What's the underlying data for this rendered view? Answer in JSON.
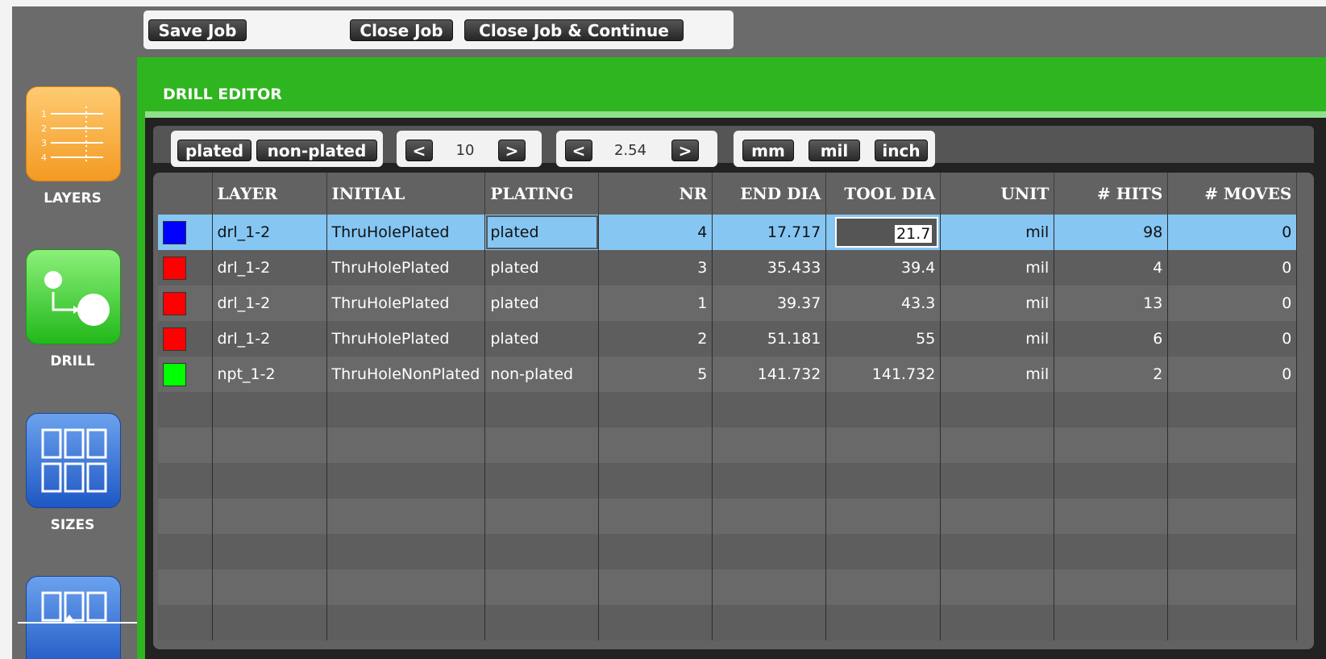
{
  "toolbar": {
    "save_job": "Save Job",
    "close_job": "Close Job",
    "close_continue": "Close Job & Continue"
  },
  "sidebar": {
    "items": [
      {
        "label": "LAYERS",
        "icon": "layers-icon"
      },
      {
        "label": "DRILL",
        "icon": "drill-icon"
      },
      {
        "label": "SIZES",
        "icon": "sizes-icon"
      },
      {
        "label": "",
        "icon": "sizes-icon"
      }
    ],
    "layer_numbers": [
      "1",
      "2",
      "3",
      "4"
    ]
  },
  "editor": {
    "title": "DRILL EDITOR",
    "plating_buttons": [
      "plated",
      "non-plated"
    ],
    "count_prev": "<",
    "count_value": "10",
    "count_next": ">",
    "step_prev": "<",
    "step_value": "2.54",
    "step_next": ">",
    "unit_buttons": [
      "mm",
      "mil",
      "inch"
    ]
  },
  "table": {
    "columns": [
      "",
      "LAYER",
      "INITIAL",
      "PLATING",
      "NR",
      "END DIA",
      "TOOL DIA",
      "UNIT",
      "# HITS",
      "# MOVES"
    ],
    "rows": [
      {
        "color": "#0000ff",
        "layer": "drl_1-2",
        "initial": "ThruHolePlated",
        "plating": "plated",
        "nr": "4",
        "end_dia": "17.717",
        "tool_dia": "21.7",
        "unit": "mil",
        "hits": "98",
        "moves": "0"
      },
      {
        "color": "#ff0000",
        "layer": "drl_1-2",
        "initial": "ThruHolePlated",
        "plating": "plated",
        "nr": "3",
        "end_dia": "35.433",
        "tool_dia": "39.4",
        "unit": "mil",
        "hits": "4",
        "moves": "0"
      },
      {
        "color": "#ff0000",
        "layer": "drl_1-2",
        "initial": "ThruHolePlated",
        "plating": "plated",
        "nr": "1",
        "end_dia": "39.37",
        "tool_dia": "43.3",
        "unit": "mil",
        "hits": "13",
        "moves": "0"
      },
      {
        "color": "#ff0000",
        "layer": "drl_1-2",
        "initial": "ThruHolePlated",
        "plating": "plated",
        "nr": "2",
        "end_dia": "51.181",
        "tool_dia": "55",
        "unit": "mil",
        "hits": "6",
        "moves": "0"
      },
      {
        "color": "#00ff00",
        "layer": "npt_1-2",
        "initial": "ThruHoleNonPlated",
        "plating": "non-plated",
        "nr": "5",
        "end_dia": "141.732",
        "tool_dia": "141.732",
        "unit": "mil",
        "hits": "2",
        "moves": "0"
      }
    ],
    "empty_rows": 7
  },
  "colors": {
    "accent_green": "#2fb51f",
    "selection_blue": "#86c6f3",
    "panel_gray": "#626262"
  }
}
